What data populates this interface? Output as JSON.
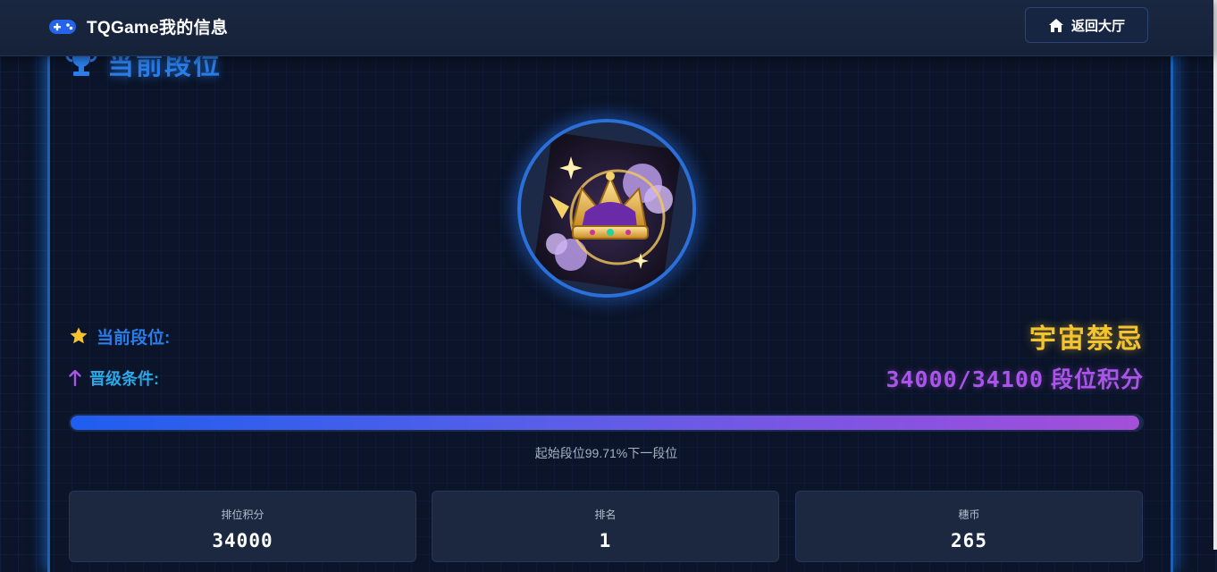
{
  "header": {
    "title": "TQGame我的信息",
    "back_button_label": "返回大厅",
    "logo_icon": "gamepad-icon",
    "back_icon": "home-icon"
  },
  "section": {
    "title": "当前段位",
    "icon": "trophy-icon"
  },
  "rank": {
    "emblem": "crown-emblem",
    "current_label": "当前段位:",
    "current_value": "宇宙禁忌",
    "promotion_label": "晋级条件:",
    "points_text": "34000/34100",
    "points_unit": "段位积分",
    "progress_percent": 99.71,
    "progress_text": "起始段位99.71%下一段位"
  },
  "stats": [
    {
      "label": "排位积分",
      "value": "34000"
    },
    {
      "label": "排名",
      "value": "1"
    },
    {
      "label": "穗币",
      "value": "265"
    }
  ],
  "colors": {
    "accent_blue": "#2a7de8",
    "rank_gold": "#f4c430",
    "points_purple": "#a855e8",
    "background": "#0b1428"
  }
}
